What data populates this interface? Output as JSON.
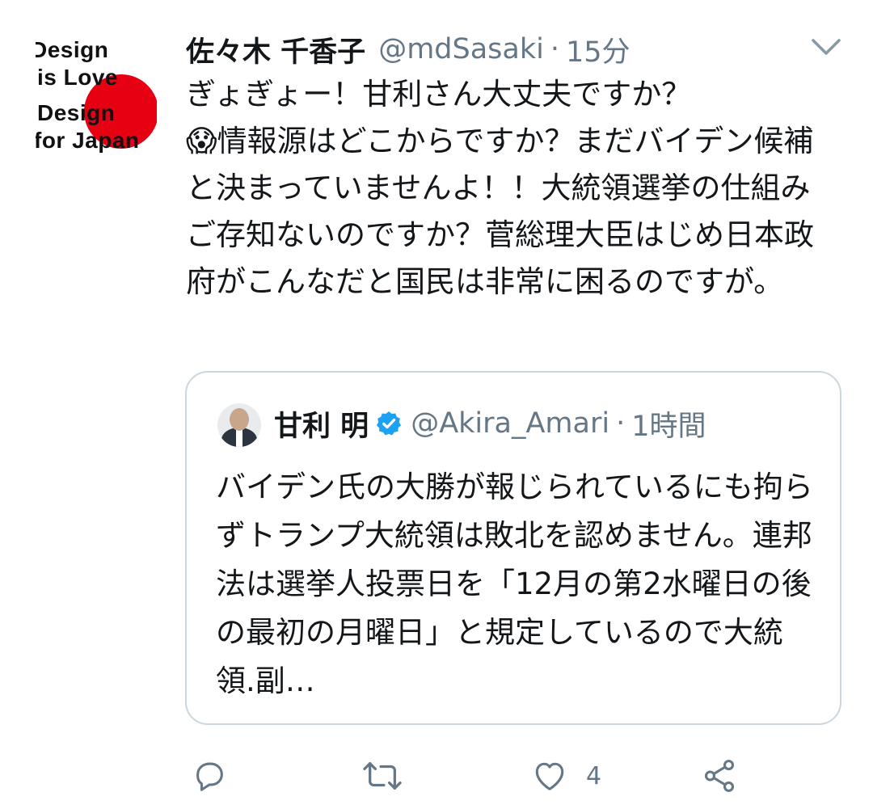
{
  "tweet": {
    "avatar": {
      "logo_lines": [
        "Design",
        "is Love",
        "Design",
        "for Japan"
      ],
      "circle_color": "#e60012"
    },
    "author": {
      "display_name": "佐々木 千香子",
      "handle": "@mdSasaki",
      "separator": "·",
      "time": "15分"
    },
    "menu_icon": "chevron-down-icon",
    "text": "ぎょぎょー！甘利さん大丈夫ですか？\n😱情報源はどこからですか？まだバイデン候補と決まっていませんよ！！大統領選挙の仕組みご存知ないのですか？菅総理大臣はじめ日本政府がこんなだと国民は非常に困るのですが。",
    "quoted": {
      "display_name": "甘利 明",
      "verified_icon": "verified-badge-icon",
      "handle": "@Akira_Amari",
      "separator": "·",
      "time": "1時間",
      "text": "バイデン氏の大勝が報じられているにも拘らずトランプ大統領は敗北を認めません。連邦法は選挙人投票日を「12月の第2水曜日の後の最初の月曜日」と規定しているので大統領.副…"
    },
    "actions": {
      "reply_icon": "reply-icon",
      "retweet_icon": "retweet-icon",
      "like_icon": "heart-icon",
      "like_count": "4",
      "share_icon": "share-icon"
    }
  },
  "colors": {
    "text_primary": "#14171a",
    "text_secondary": "#657786",
    "border": "#ccd6dd",
    "verified": "#1da1f2"
  }
}
